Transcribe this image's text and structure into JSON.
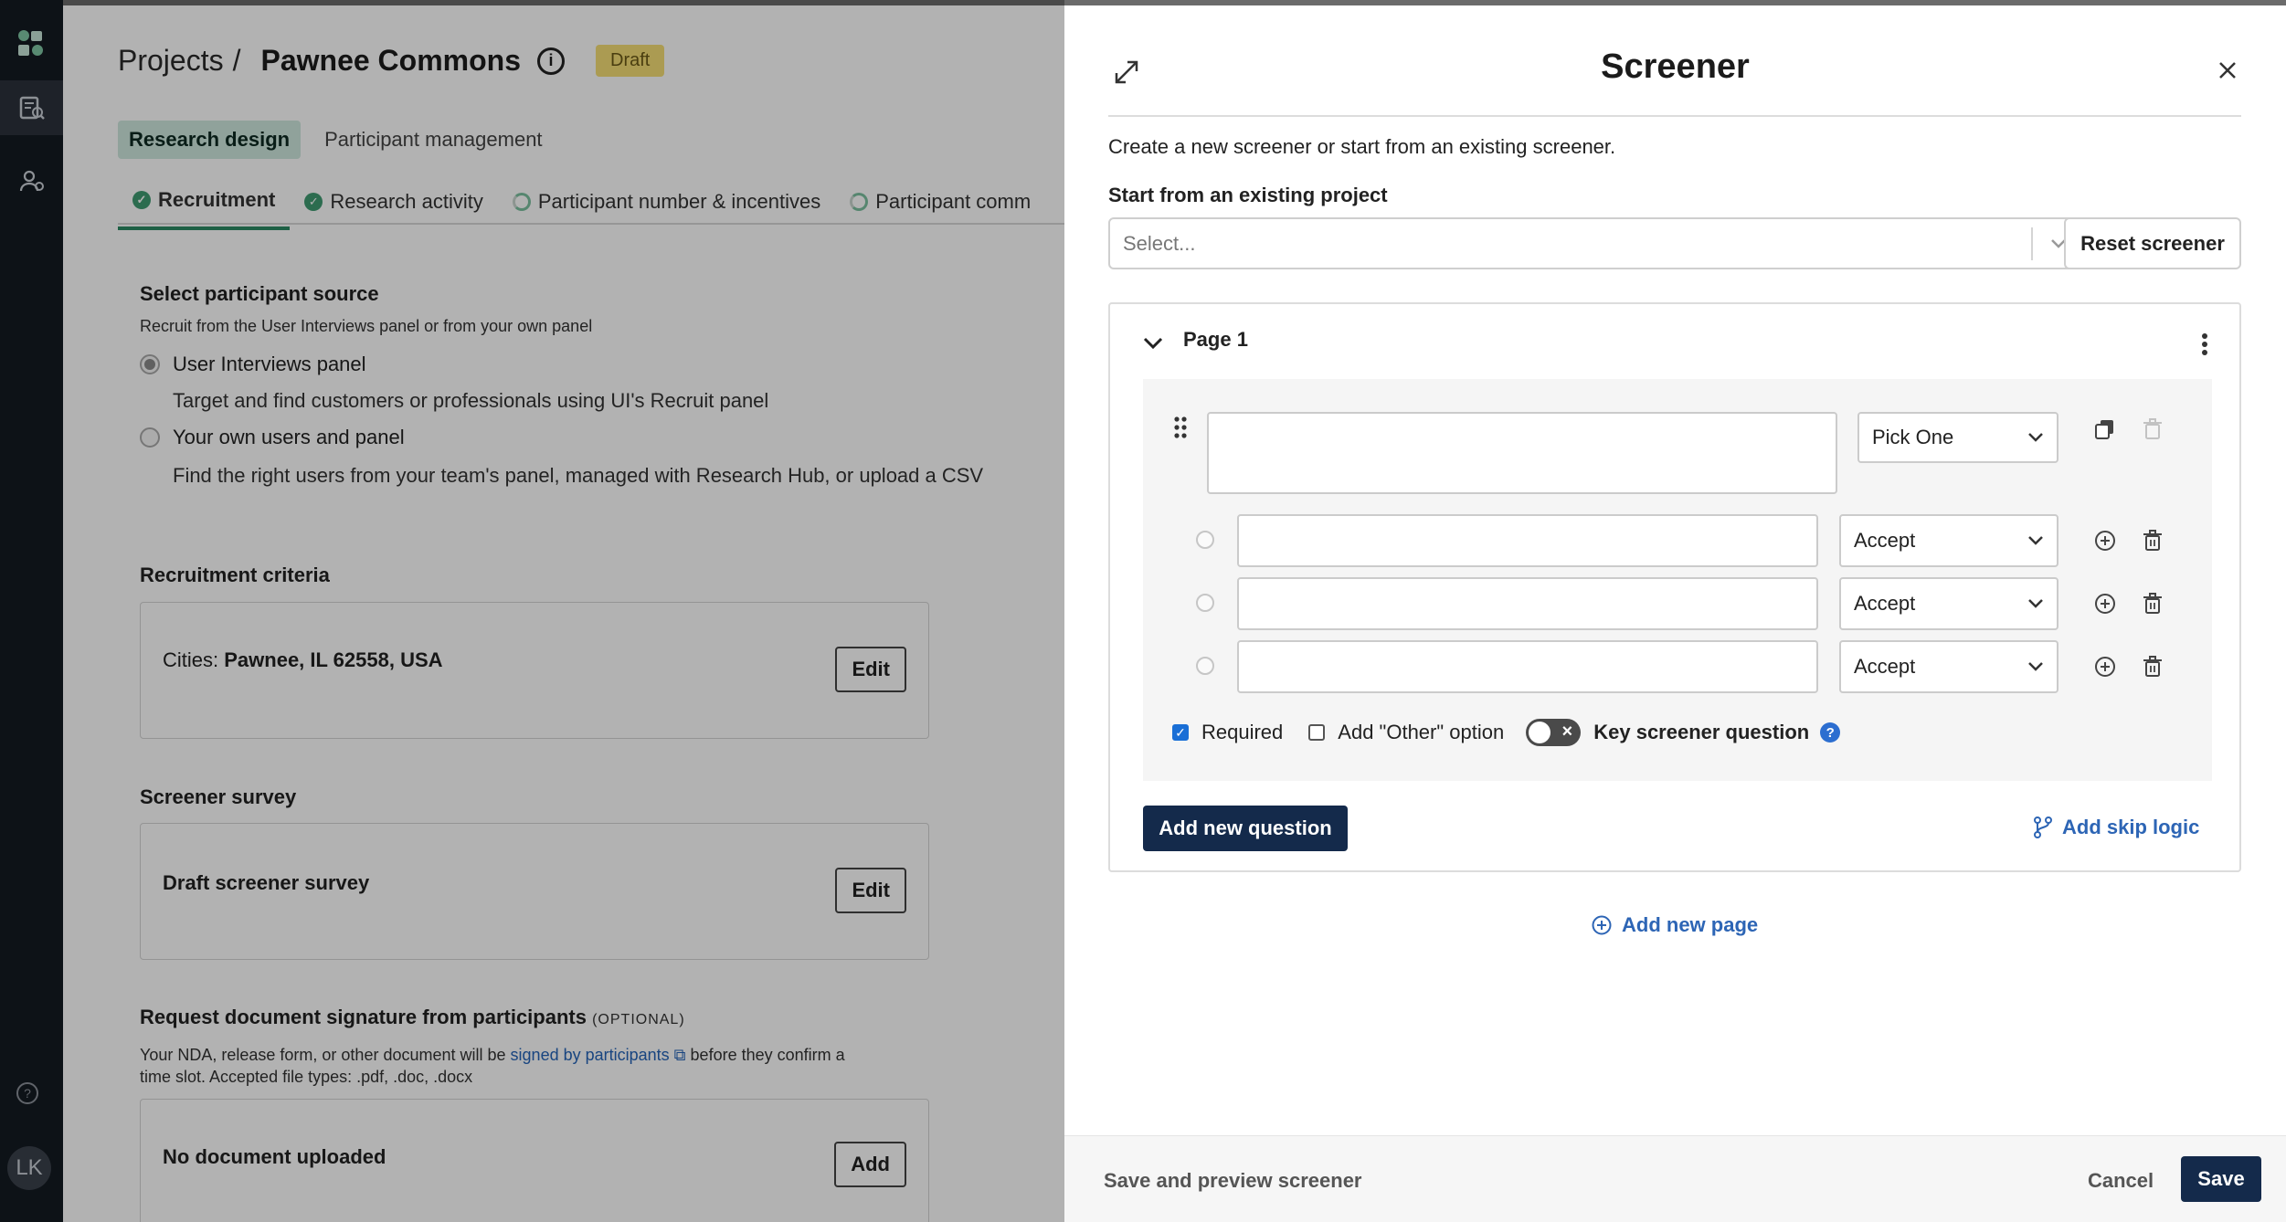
{
  "rail": {
    "avatar_initials": "LK",
    "icons": [
      "app-logo-icon",
      "research-project-icon",
      "people-icon",
      "help-icon"
    ]
  },
  "page": {
    "breadcrumb": {
      "parent": "Projects",
      "separator": "/",
      "project": "Pawnee Commons"
    },
    "status_badge": "Draft",
    "tabs": [
      {
        "label": "Research design",
        "active": true
      },
      {
        "label": "Participant management",
        "active": false
      }
    ],
    "subtabs": [
      {
        "label": "Recruitment",
        "state": "complete",
        "active": true
      },
      {
        "label": "Research activity",
        "state": "complete",
        "active": false
      },
      {
        "label": "Participant number & incentives",
        "state": "in-progress",
        "active": false
      },
      {
        "label": "Participant comm",
        "state": "in-progress",
        "active": false
      }
    ],
    "source": {
      "title": "Select participant source",
      "subtitle": "Recruit from the User Interviews panel or from your own panel",
      "options": [
        {
          "label": "User Interviews panel",
          "description": "Target and find customers or professionals using UI's Recruit panel",
          "selected": true
        },
        {
          "label": "Your own users and panel",
          "description": "Find the right users from your team's panel, managed with Research Hub, or upload a CSV",
          "selected": false
        }
      ]
    },
    "criteria": {
      "title": "Recruitment criteria",
      "label": "Cities:",
      "value": "Pawnee, IL 62558, USA",
      "edit_label": "Edit"
    },
    "screener": {
      "title": "Screener survey",
      "value": "Draft screener survey",
      "edit_label": "Edit"
    },
    "signature": {
      "title": "Request document signature from participants",
      "optional": "(OPTIONAL)",
      "text_before": "Your NDA, release form, or other document will be",
      "link": "signed by participants",
      "text_after": "before they confirm a",
      "text_line2": "time slot. Accepted file types: .pdf, .doc, .docx",
      "empty": "No document uploaded",
      "add_label": "Add"
    }
  },
  "drawer": {
    "title": "Screener",
    "intro": "Create a new screener or start from an existing screener.",
    "existing_label": "Start from an existing project",
    "existing_placeholder": "Select...",
    "reset_label": "Reset screener",
    "page_title": "Page 1",
    "question": {
      "text": "",
      "type": "Pick One",
      "options": [
        {
          "value": "",
          "rule": "Accept"
        },
        {
          "value": "",
          "rule": "Accept"
        },
        {
          "value": "",
          "rule": "Accept"
        }
      ],
      "required_label": "Required",
      "required": true,
      "other_label": "Add \"Other\" option",
      "other": false,
      "key_label": "Key screener question",
      "key": false,
      "help_glyph": "?"
    },
    "add_question_label": "Add new question",
    "skip_logic_label": "Add skip logic",
    "add_page_label": "Add new page",
    "footer": {
      "preview_label": "Save and preview screener",
      "cancel_label": "Cancel",
      "save_label": "Save"
    }
  },
  "colors": {
    "rail": "#141a21",
    "primary_button": "#142a4b",
    "link": "#2d65b5",
    "active_tab_bg": "#cfe8df",
    "badge": "#f5df76"
  }
}
